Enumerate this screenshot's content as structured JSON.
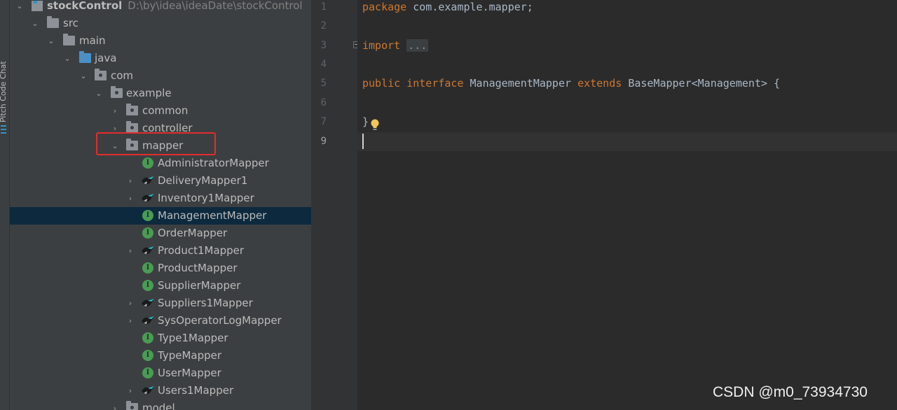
{
  "side_panel": {
    "label": "Pitch Code Chat"
  },
  "project_tree": {
    "root_name": "stockControl",
    "root_path": "D:\\by\\idea\\ideaDate\\stockControl",
    "nodes": [
      {
        "label": "src"
      },
      {
        "label": "main"
      },
      {
        "label": "java"
      },
      {
        "label": "com"
      },
      {
        "label": "example"
      },
      {
        "label": "common"
      },
      {
        "label": "controller"
      },
      {
        "label": "mapper"
      },
      {
        "label": "AdministratorMapper"
      },
      {
        "label": "DeliveryMapper1"
      },
      {
        "label": "Inventory1Mapper"
      },
      {
        "label": "ManagementMapper"
      },
      {
        "label": "OrderMapper"
      },
      {
        "label": "Product1Mapper"
      },
      {
        "label": "ProductMapper"
      },
      {
        "label": "SupplierMapper"
      },
      {
        "label": "Suppliers1Mapper"
      },
      {
        "label": "SysOperatorLogMapper"
      },
      {
        "label": "Type1Mapper"
      },
      {
        "label": "TypeMapper"
      },
      {
        "label": "UserMapper"
      },
      {
        "label": "Users1Mapper"
      },
      {
        "label": "model"
      }
    ],
    "selected": "ManagementMapper",
    "highlighted": "mapper"
  },
  "editor": {
    "line_numbers": [
      "1",
      "2",
      "3",
      "4",
      "5",
      "6",
      "7",
      "8",
      "9"
    ],
    "current_line": "9",
    "code": {
      "l1_kw": "package",
      "l1_rest": " com.example.mapper;",
      "l3_kw": "import",
      "l3_fold": "...",
      "l6_kw1": "public",
      "l6_kw2": "interface",
      "l6_name": "ManagementMapper",
      "l6_kw3": "extends",
      "l6_rest": "BaseMapper<Management> {",
      "l8": "}"
    }
  },
  "watermark": "CSDN @m0_73934730",
  "colors": {
    "keyword": "#cc7832",
    "code_text": "#a9b7c6",
    "interface_icon": "#499c54",
    "highlight_box": "#e22d2d",
    "selection": "#0d293e"
  }
}
